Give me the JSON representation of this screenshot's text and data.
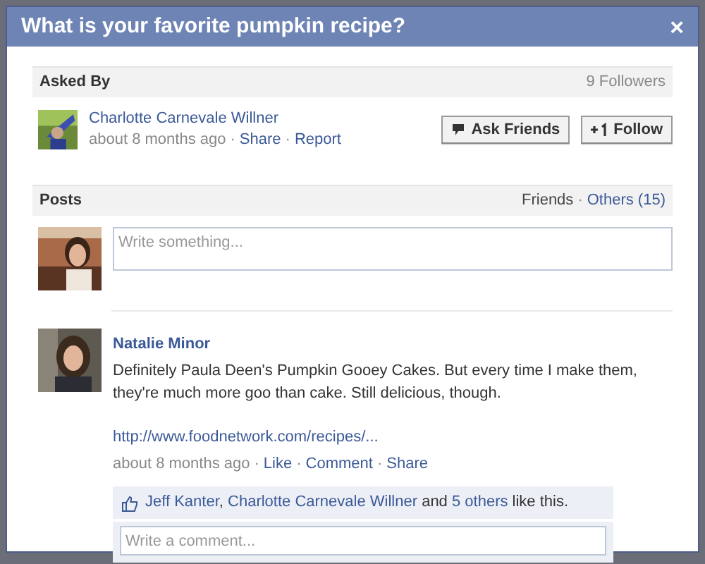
{
  "dialog": {
    "title": "What is your favorite pumpkin recipe?",
    "close": "×"
  },
  "asked_by": {
    "heading": "Asked By",
    "followers": "9 Followers",
    "author": "Charlotte Carnevale Willner",
    "time": "about 8 months ago",
    "separator": "·",
    "actions": [
      "Share",
      "Report"
    ],
    "buttons": [
      {
        "kind": "ask",
        "label": "Ask Friends"
      },
      {
        "kind": "follow",
        "label": "Follow"
      }
    ]
  },
  "posts": {
    "heading": "Posts",
    "separator": "·",
    "filters": [
      {
        "label": "Friends",
        "selected": true
      },
      {
        "label": "Others (15)",
        "selected": false
      }
    ],
    "composer": {
      "placeholder": "Write something..."
    },
    "items": [
      {
        "author": "Natalie Minor",
        "text": "Definitely Paula Deen's Pumpkin Gooey Cakes. But every time I make them, they're much more goo than cake. Still delicious, though.",
        "link": "http://www.foodnetwork.com/recipes/...",
        "time": "about 8 months ago",
        "separator": "·",
        "actions": [
          "Like",
          "Comment",
          "Share"
        ],
        "likes": [
          {
            "kind": "link",
            "text": "Jeff Kanter"
          },
          {
            "kind": "plain",
            "text": ", "
          },
          {
            "kind": "link",
            "text": "Charlotte Carnevale Willner"
          },
          {
            "kind": "plain",
            "text": " and "
          },
          {
            "kind": "link",
            "text": "5 others"
          },
          {
            "kind": "plain",
            "text": " like this."
          }
        ],
        "comment": {
          "placeholder": "Write a comment..."
        }
      }
    ]
  }
}
